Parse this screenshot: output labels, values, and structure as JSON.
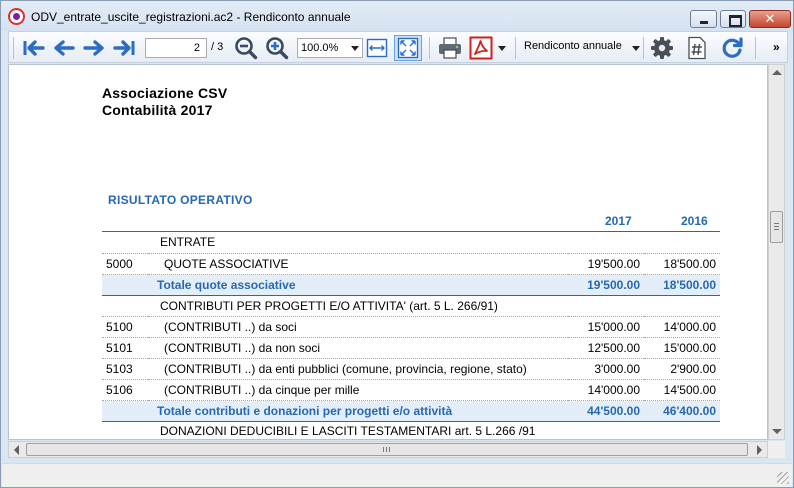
{
  "window": {
    "title": "ODV_entrate_uscite_registrazioni.ac2 - Rendiconto annuale",
    "close_label": "✕"
  },
  "toolbar": {
    "current_page": "2",
    "page_total": "/ 3",
    "zoom": "100.0%",
    "report_selector": "Rendiconto annuale",
    "overflow": "»"
  },
  "report": {
    "org_name": "Associazione CSV",
    "subtitle": "Contabilità 2017",
    "section_title": "RISULTATO OPERATIVO",
    "year_current": "2017",
    "year_previous": "2016",
    "rows": [
      {
        "code": "",
        "desc": "ENTRATE",
        "v2017": "",
        "v2016": "",
        "type": "group"
      },
      {
        "code": "5000",
        "desc": "QUOTE ASSOCIATIVE",
        "v2017": "19'500.00",
        "v2016": "18'500.00",
        "type": "item"
      },
      {
        "code": "",
        "desc": "Totale quote associative",
        "v2017": "19'500.00",
        "v2016": "18'500.00",
        "type": "total"
      },
      {
        "code": "",
        "desc": "CONTRIBUTI PER PROGETTI E/O ATTIVITA'  (art. 5 L. 266/91)",
        "v2017": "",
        "v2016": "",
        "type": "group"
      },
      {
        "code": "5100",
        "desc": "(CONTRIBUTI ..) da soci",
        "v2017": "15'000.00",
        "v2016": "14'000.00",
        "type": "item"
      },
      {
        "code": "5101",
        "desc": "(CONTRIBUTI ..) da non soci",
        "v2017": "12'500.00",
        "v2016": "15'000.00",
        "type": "item"
      },
      {
        "code": "5103",
        "desc": "(CONTRIBUTI ..)  da enti pubblici (comune, provincia, regione, stato)",
        "v2017": "3'000.00",
        "v2016": "2'900.00",
        "type": "item"
      },
      {
        "code": "5106",
        "desc": "(CONTRIBUTI ..) da cinque per mille",
        "v2017": "14'000.00",
        "v2016": "14'500.00",
        "type": "item"
      },
      {
        "code": "",
        "desc": "Totale contributi e donazioni per progetti e/o attività",
        "v2017": "44'500.00",
        "v2016": "46'400.00",
        "type": "total"
      },
      {
        "code": "",
        "desc": "DONAZIONI DEDUCIBILI E LASCITI TESTAMENTARI art. 5 L.266 /91",
        "v2017": "",
        "v2016": "",
        "type": "group"
      }
    ]
  },
  "colors": {
    "accent": "#2568b3",
    "total_row_bg": "#e4eef8",
    "toolbar_icon_blue": "#2b6cc4",
    "pdf_red": "#d0201a"
  },
  "icons": [
    "first-page-icon",
    "previous-page-icon",
    "next-page-icon",
    "last-page-icon",
    "zoom-out-icon",
    "zoom-in-icon",
    "fit-width-icon",
    "fit-page-icon",
    "print-icon",
    "pdf-icon",
    "settings-gear-icon",
    "number-format-icon",
    "refresh-icon"
  ]
}
